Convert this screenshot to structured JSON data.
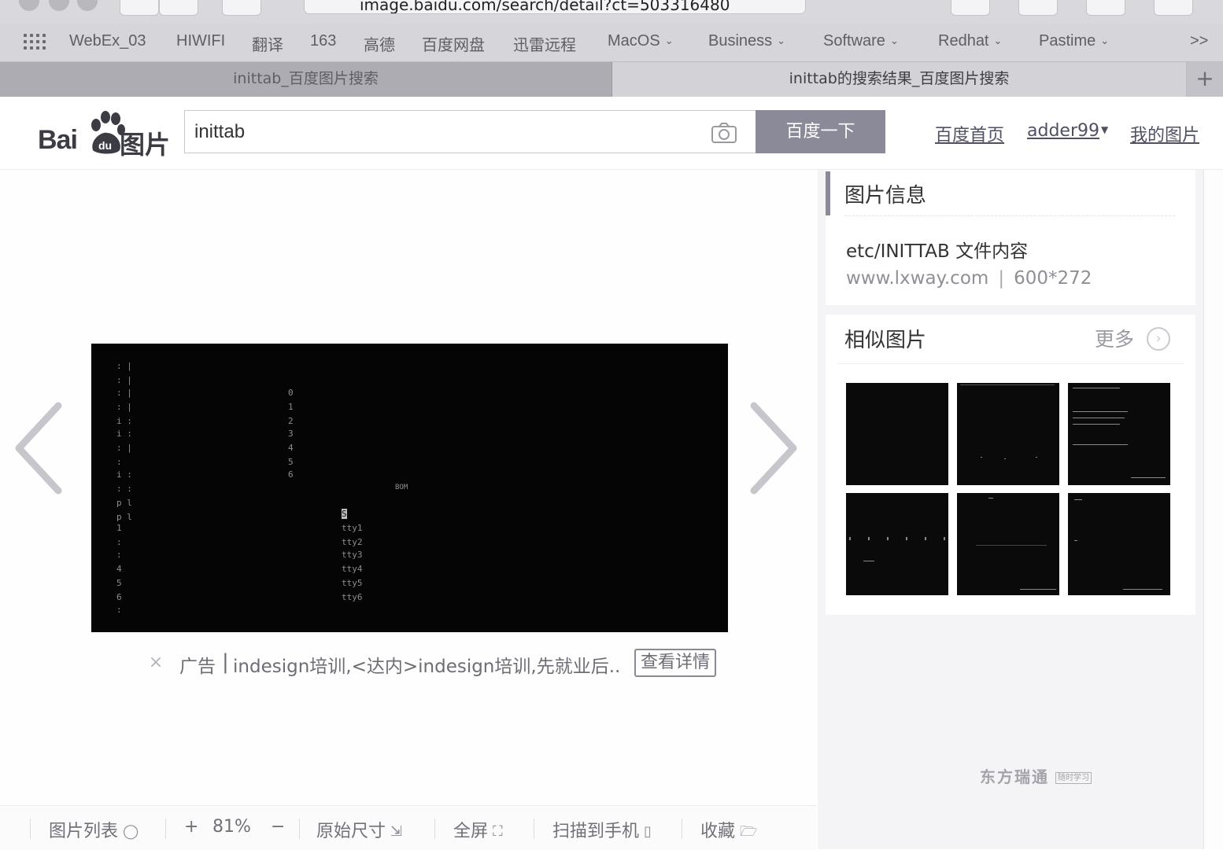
{
  "browser": {
    "url": "image.baidu.com/search/detail?ct=503316480",
    "bookmarks": [
      "WebEx_03",
      "HIWIFI",
      "翻译",
      "163",
      "高德",
      "百度网盘",
      "迅雷远程",
      "MacOS",
      "Business",
      "Software",
      "Redhat",
      "Pastime"
    ],
    "overflow": ">>",
    "tabs": [
      {
        "label": "inittab_百度图片搜索"
      },
      {
        "label": "inittab的搜索结果_百度图片搜索"
      }
    ],
    "new_tab": "+"
  },
  "header": {
    "logo_text": "Bai",
    "logo_du": "du",
    "logo_suffix": "图片",
    "search_value": "inittab",
    "search_button": "百度一下",
    "links": {
      "home": "百度首页",
      "user": "adder99",
      "my_pics": "我的图片"
    }
  },
  "viewer": {
    "terminal_lines": [
      "0",
      "1",
      "2",
      "3",
      "4",
      "5",
      "6",
      "S",
      "tty1",
      "tty2",
      "tty3",
      "tty4",
      "tty5",
      "tty6",
      "BOM"
    ],
    "ad": {
      "label": "广告",
      "separator": "|",
      "text": "indesign培训,<达内>indesign培训,先就业后...",
      "button": "查看详情"
    }
  },
  "info_panel": {
    "title": "图片信息",
    "description": "etc/INITTAB 文件内容",
    "source": "www.lxway.com",
    "separator": "|",
    "dimensions": "600*272"
  },
  "similar": {
    "title": "相似图片",
    "more": "更多"
  },
  "watermark": {
    "text": "东方瑞通",
    "badge": "随时学习"
  },
  "toolbar": {
    "list": "图片列表",
    "zoom_in": "+",
    "zoom": "81%",
    "zoom_out": "−",
    "original": "原始尺寸",
    "fullscreen": "全屏",
    "scan": "扫描到手机",
    "favorite": "收藏"
  }
}
